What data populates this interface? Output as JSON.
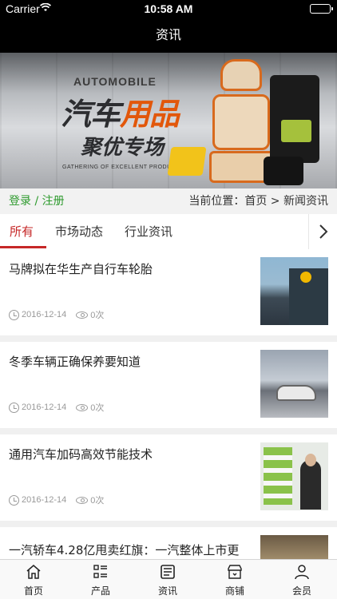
{
  "status_bar": {
    "carrier": "Carrier",
    "time": "10:58 AM",
    "wifi_icon": "wifi-icon",
    "battery_icon": "battery-icon"
  },
  "nav": {
    "title": "资讯"
  },
  "banner": {
    "en_title": "AUTOMOBILE",
    "cn_title_black": "汽车",
    "cn_title_orange": "用品",
    "cn_subtitle": "聚优专场",
    "en_subtitle": "GATHERING OF EXCELLENT PRODUCTS"
  },
  "login_row": {
    "login_text": "登录 / 注册",
    "location_text": "当前位置：首页 > 新闻资讯",
    "login_color": "#2d9a2d"
  },
  "tabs": {
    "items": [
      {
        "label": "所有",
        "active": true
      },
      {
        "label": "市场动态",
        "active": false
      },
      {
        "label": "行业资讯",
        "active": false
      }
    ],
    "more_icon": "chevron-right-icon",
    "active_color": "#c62828"
  },
  "news": [
    {
      "title": "马牌拟在华生产自行车轮胎",
      "date": "2016-12-14",
      "views": "0次"
    },
    {
      "title": "冬季车辆正确保养要知道",
      "date": "2016-12-14",
      "views": "0次"
    },
    {
      "title": "通用汽车加码高效节能技术",
      "date": "2016-12-14",
      "views": "0次"
    },
    {
      "title": "一汽轿车4.28亿甩卖红旗：一汽整体上市更",
      "date": "",
      "views": ""
    }
  ],
  "tab_bar": {
    "items": [
      {
        "label": "首页",
        "icon": "home-icon"
      },
      {
        "label": "产品",
        "icon": "list-icon"
      },
      {
        "label": "资讯",
        "icon": "news-icon"
      },
      {
        "label": "商铺",
        "icon": "shop-icon"
      },
      {
        "label": "会员",
        "icon": "user-icon"
      }
    ]
  }
}
